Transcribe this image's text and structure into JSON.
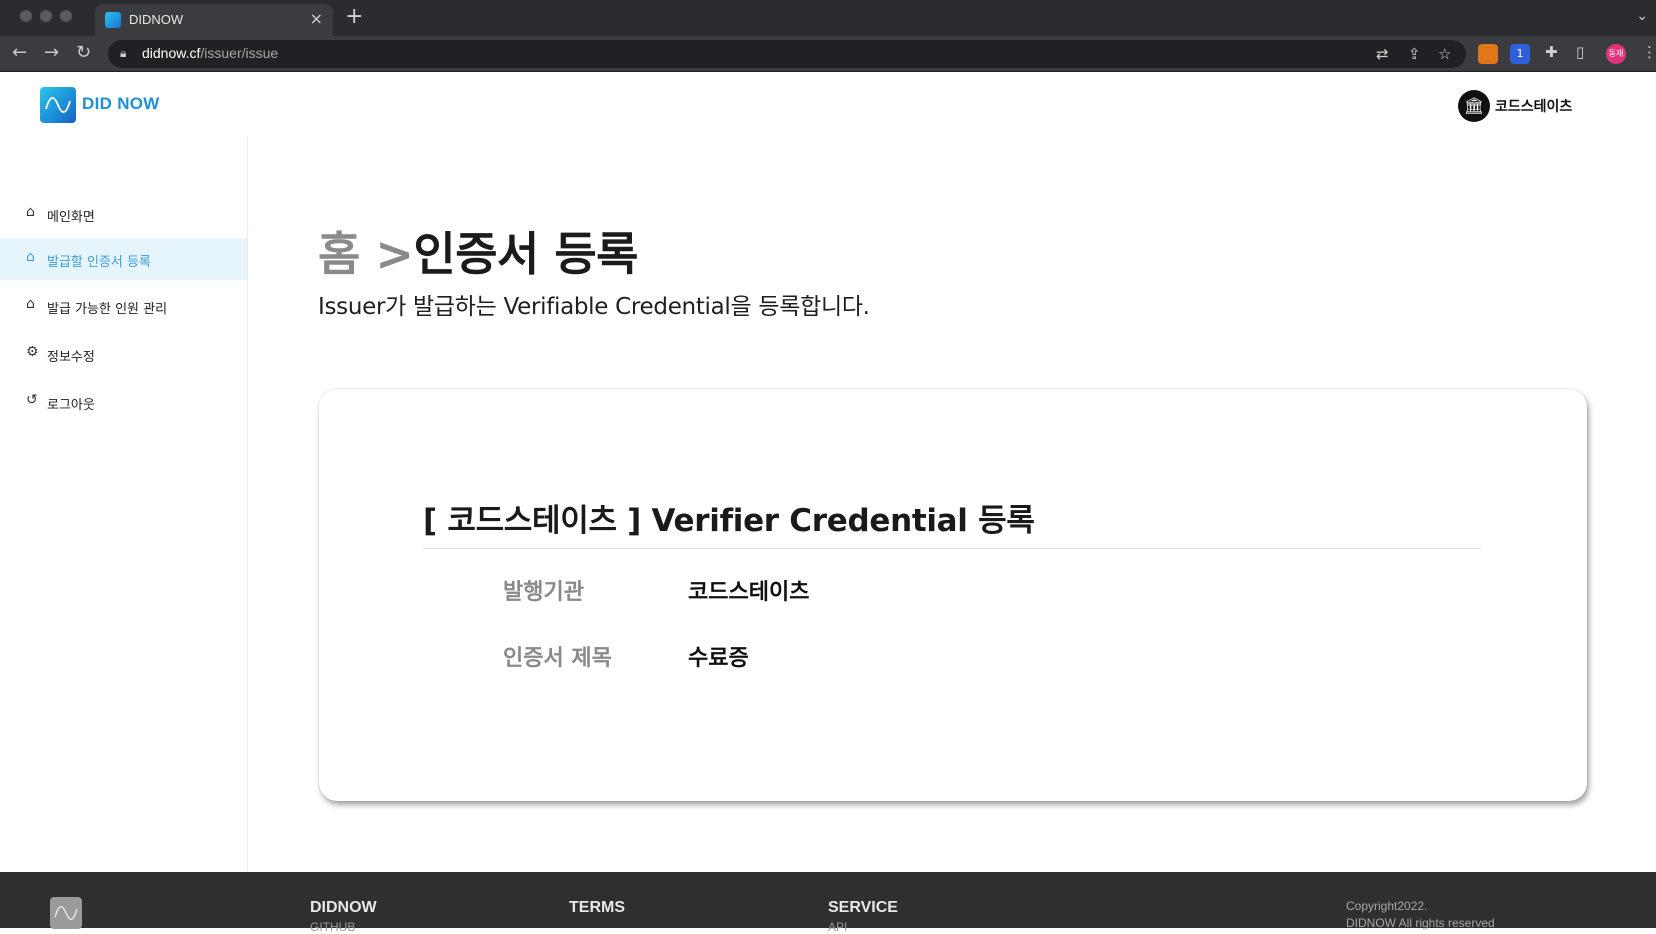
{
  "browser": {
    "tab_title": "DIDNOW",
    "tab_close": "×",
    "new_tab": "+",
    "url_host": "didnow.cf",
    "url_path": "/issuer/issue",
    "profile_badge": "동재",
    "ext_badge": "1"
  },
  "header": {
    "logo_text": "DID NOW",
    "user_name": "코드스테이츠"
  },
  "sidebar": {
    "items": [
      {
        "label": "메인화면",
        "icon": "home-icon"
      },
      {
        "label": "발급할 인증서 등록",
        "icon": "home-icon"
      },
      {
        "label": "발급 가능한 인원 관리",
        "icon": "home-icon"
      },
      {
        "label": "정보수정",
        "icon": "gear-icon"
      },
      {
        "label": "로그아웃",
        "icon": "logout-icon"
      }
    ]
  },
  "main": {
    "breadcrumb_home": "홈",
    "breadcrumb_sep": ">",
    "breadcrumb_current": "인증서 등록",
    "subtitle": "Issuer가 발급하는 Verifiable Credential을 등록합니다.",
    "card": {
      "title": "[ 코드스테이츠 ] Verifier Credential 등록",
      "rows": [
        {
          "label": "발행기관",
          "value": "코드스테이츠"
        },
        {
          "label": "인증서 제목",
          "value": "수료증"
        }
      ]
    }
  },
  "footer": {
    "col1_title": "DIDNOW",
    "col1_sub": "GITHUB",
    "col2_title": "TERMS",
    "col3_title": "SERVICE",
    "col3_sub": "API",
    "copyright_line1": "Copyright2022.",
    "copyright_line2": "DIDNOW All rights reserved"
  },
  "colors": {
    "accent": "#3aa0d8",
    "active_bg": "#e6f4fc",
    "footer_bg": "#2f2f2f"
  }
}
